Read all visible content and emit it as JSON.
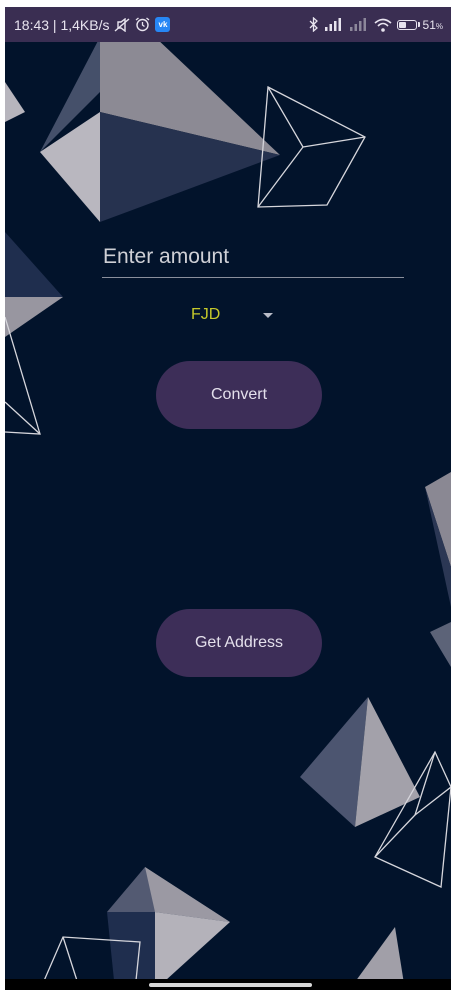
{
  "status_bar": {
    "time_speed": "18:43 | 1,4KB/s",
    "vk_badge": "vk",
    "battery_level_percent": 51,
    "battery_label": "51",
    "battery_suffix": "%",
    "icons": [
      "mute-icon",
      "alarm-icon",
      "vk-icon",
      "bluetooth-icon",
      "signal-icon",
      "signal-icon",
      "wifi-icon",
      "battery-icon"
    ]
  },
  "form": {
    "amount_placeholder": "Enter amount",
    "amount_value": "",
    "currency_selected": "FJD",
    "convert_label": "Convert",
    "get_address_label": "Get Address"
  },
  "colors": {
    "background": "#02132b",
    "status_bar": "#3a2e52",
    "button": "#3d2e58",
    "currency_text": "#c5c92b"
  }
}
